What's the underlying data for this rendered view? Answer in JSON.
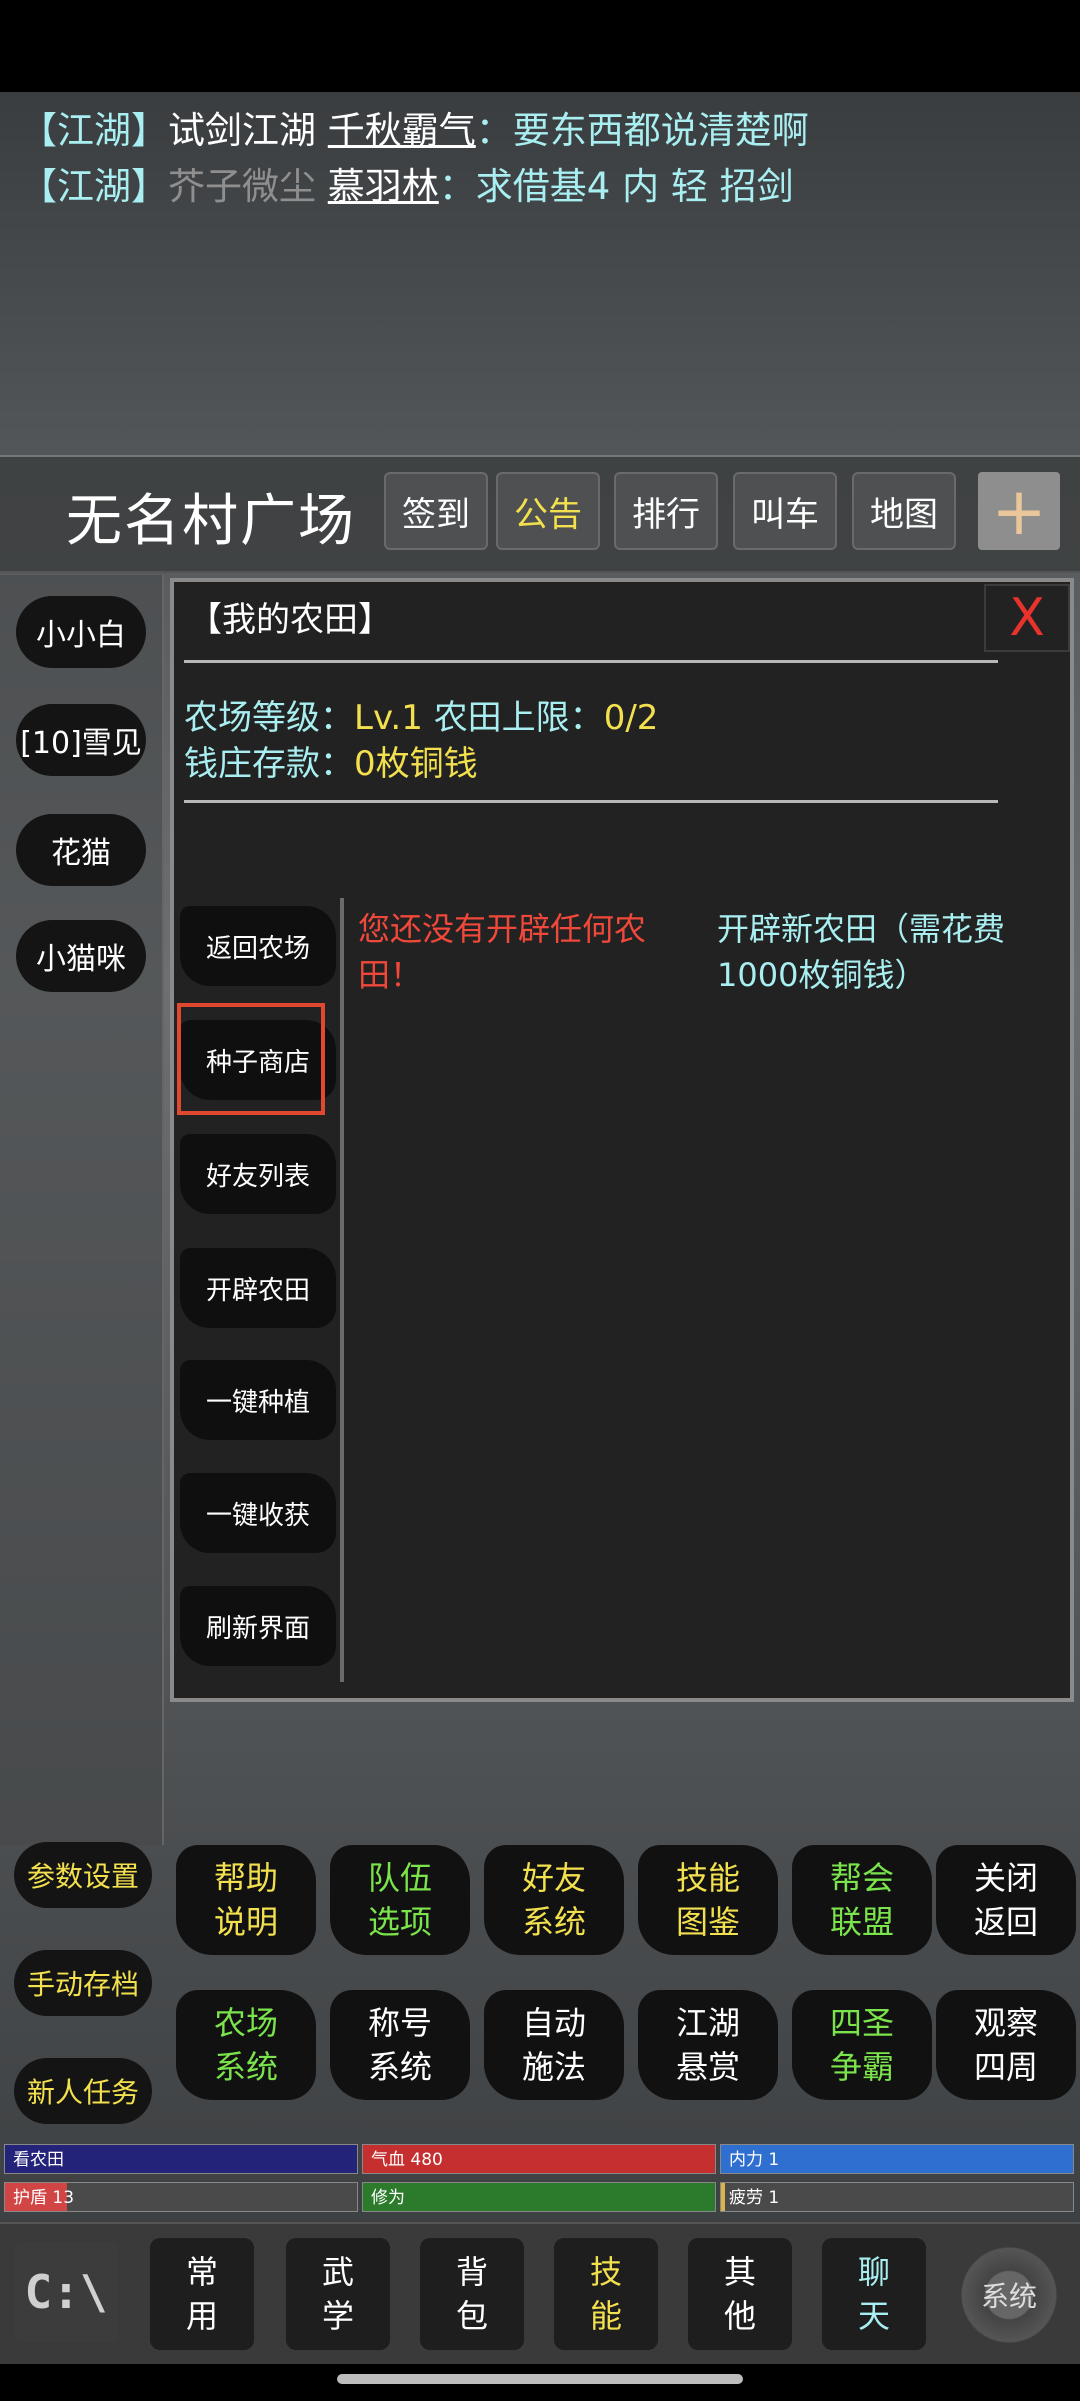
{
  "chat": [
    {
      "channel": "【江湖】",
      "sender": "试剑江湖",
      "target": "千秋霸气",
      "message": "：要东西都说清楚啊"
    },
    {
      "channel": "【江湖】",
      "sender": "芥子微尘",
      "target": "慕羽林",
      "message": "：求借基4 内 轻 招剑"
    }
  ],
  "location": {
    "title": "无名村广场",
    "buttons": [
      "签到",
      "公告",
      "排行",
      "叫车",
      "地图"
    ],
    "plus": "+"
  },
  "npcs": [
    "小小白",
    "[10]雪见",
    "花猫",
    "小猫咪"
  ],
  "panel": {
    "title": "【我的农田】",
    "close": "X",
    "farm_level_label": "农场等级：",
    "farm_level_value": "Lv.1",
    "field_limit_label": "农田上限：",
    "field_limit_value": "0/2",
    "deposit_label": "钱庄存款：",
    "deposit_value": "0枚铜钱",
    "menu": [
      "返回农场",
      "种子商店",
      "好友列表",
      "开辟农田",
      "一键种植",
      "一键收获",
      "刷新界面"
    ],
    "no_field_msg": "您还没有开辟任何农田！",
    "open_field_msg": "开辟新农田（需花费1000枚铜钱）"
  },
  "side_buttons": [
    "参数设置",
    "手动存档",
    "新人任务"
  ],
  "grid_row1": [
    {
      "l1": "帮助",
      "l2": "说明",
      "color": "#f3e04e"
    },
    {
      "l1": "队伍",
      "l2": "选项",
      "color": "#7be34b"
    },
    {
      "l1": "好友",
      "l2": "系统",
      "color": "#f3e04e"
    },
    {
      "l1": "技能",
      "l2": "图鉴",
      "color": "#f3e04e"
    },
    {
      "l1": "帮会",
      "l2": "联盟",
      "color": "#7be34b"
    },
    {
      "l1": "关闭",
      "l2": "返回",
      "color": "#ffffff"
    }
  ],
  "grid_row2": [
    {
      "l1": "农场",
      "l2": "系统",
      "color": "#7be34b"
    },
    {
      "l1": "称号",
      "l2": "系统",
      "color": "#ffffff"
    },
    {
      "l1": "自动",
      "l2": "施法",
      "color": "#ffffff"
    },
    {
      "l1": "江湖",
      "l2": "悬赏",
      "color": "#ffffff"
    },
    {
      "l1": "四圣",
      "l2": "争霸",
      "color": "#7be34b"
    },
    {
      "l1": "观察",
      "l2": "四周",
      "color": "#ffffff"
    }
  ],
  "stats": {
    "status": "看农田",
    "hp": "气血 480",
    "mp": "内力 1",
    "shield": "护盾 13",
    "cultivation": "修为",
    "fatigue": "疲劳 1",
    "colors": {
      "status": "#23237a",
      "hp": "#c62f2f",
      "mp": "#2f6fd0",
      "shield": "#d24545",
      "cultivation": "#2c7a2c",
      "fatigue": "#d8b44a"
    }
  },
  "tabs": [
    {
      "l1": "常",
      "l2": "用",
      "color": "#ffffff"
    },
    {
      "l1": "武",
      "l2": "学",
      "color": "#ffffff"
    },
    {
      "l1": "背",
      "l2": "包",
      "color": "#ffffff"
    },
    {
      "l1": "技",
      "l2": "能",
      "color": "#f3e04e"
    },
    {
      "l1": "其",
      "l2": "他",
      "color": "#ffffff"
    },
    {
      "l1": "聊",
      "l2": "天",
      "color": "#a9eef0"
    }
  ],
  "console_icon": "C:\\",
  "settings_icon": "系统"
}
